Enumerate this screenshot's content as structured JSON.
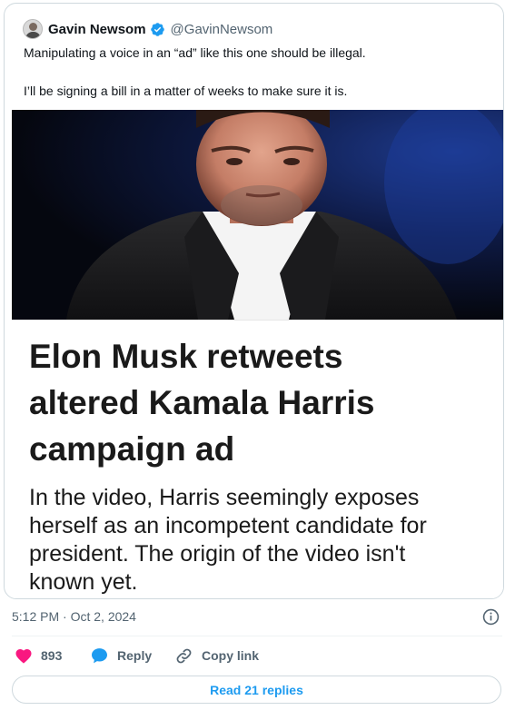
{
  "tweet": {
    "author_name": "Gavin Newsom",
    "handle": "@GavinNewsom",
    "text_line1": "Manipulating a voice in an “ad” like this one should be illegal.",
    "text_line2": "I’ll be signing a bill in a matter of weeks to make sure it is.",
    "timestamp": "5:12 PM · Oct 2, 2024"
  },
  "media": {
    "headline_lines": [
      "Elon Musk retweets",
      "altered Kamala Harris",
      "campaign ad"
    ],
    "dek_lines": [
      "In the video, Harris seemingly exposes",
      "herself as an incompetent candidate for",
      "president. The origin of the video isn't",
      "known yet."
    ]
  },
  "actions": {
    "like_count": "893",
    "reply_label": "Reply",
    "copy_link_label": "Copy link",
    "read_replies_label": "Read 21 replies"
  },
  "colors": {
    "accent": "#1d9bf0",
    "like": "#f91880",
    "secondary_text": "#536471",
    "border": "#cfd9de"
  },
  "icons": [
    "verified-badge-icon",
    "heart-icon",
    "reply-bubble-icon",
    "link-icon",
    "info-icon"
  ]
}
